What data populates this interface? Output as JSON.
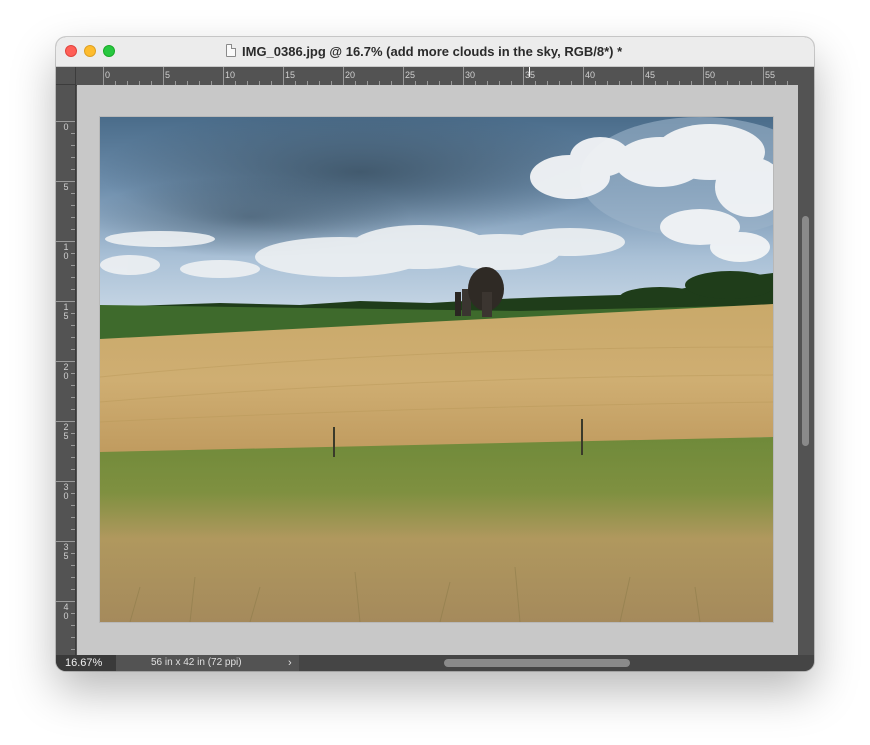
{
  "window": {
    "title": "IMG_0386.jpg @ 16.7% (add more clouds in the sky, RGB/8*) *"
  },
  "ruler": {
    "horizontal": [
      "0",
      "5",
      "10",
      "15",
      "20",
      "25",
      "30",
      "35",
      "40",
      "45",
      "50",
      "55"
    ],
    "vertical": [
      "0",
      "5",
      "1\n0",
      "1\n5",
      "2\n0",
      "2\n5",
      "3\n0",
      "3\n5",
      "4\n0"
    ]
  },
  "status": {
    "zoom": "16.67%",
    "doc_size": "56 in x 42 in (72 ppi)",
    "more_icon": "chevron-right-icon"
  },
  "colors": {
    "chrome": "#535353",
    "canvas_bg": "#c8c8c8",
    "titlebar": "#ececec"
  }
}
